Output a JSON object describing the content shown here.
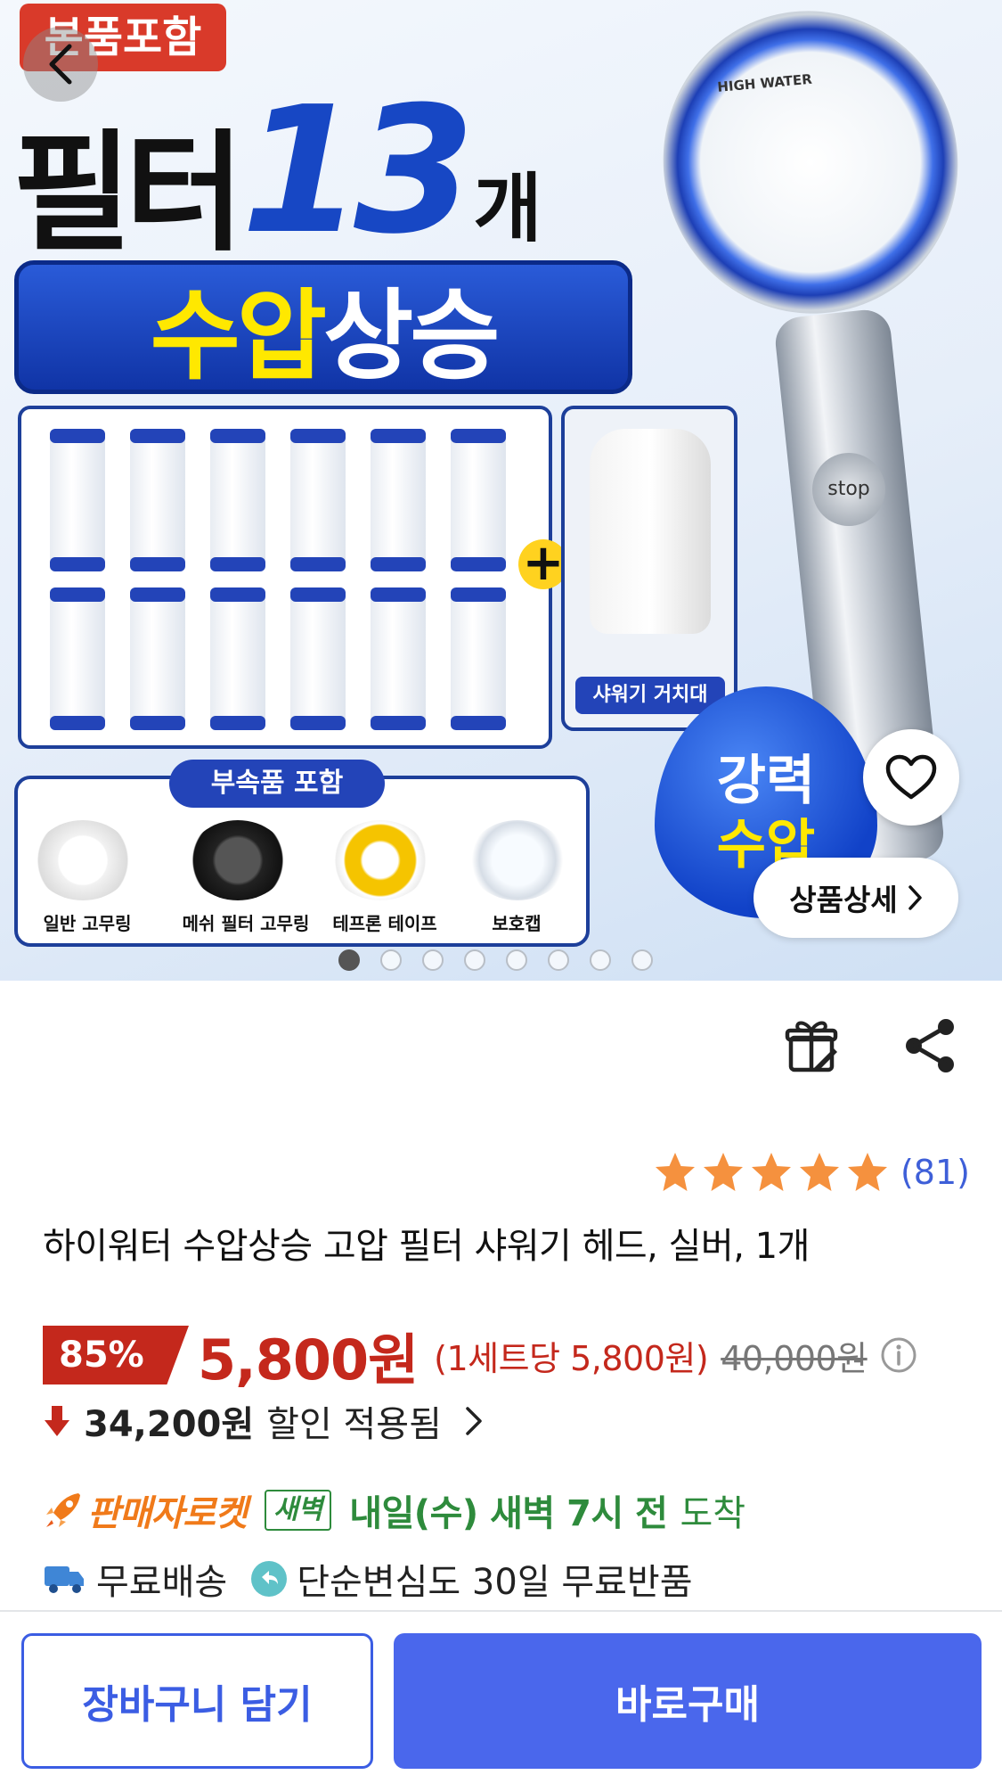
{
  "hero": {
    "badge": "본품포함",
    "title_part1": "필터",
    "title_part2": "13",
    "title_part3": "개",
    "banner_yellow": "수압",
    "banner_white": "상승",
    "shower_head_label": "HIGH WATER",
    "stop_label": "stop",
    "holder_label": "샤워기 거치대",
    "accessories_title": "부속품 포함",
    "accessories": [
      "일반 고무링",
      "메쉬 필터 고무링",
      "테프론 테이프",
      "보호캡"
    ],
    "drop_line1": "강력",
    "drop_line2": "수압",
    "detail_button": "상품상세",
    "slide_count": 8,
    "active_slide": 1
  },
  "product": {
    "rating": 5,
    "review_count": "(81)",
    "title": "하이워터 수압상승 고압 필터 샤워기 헤드, 실버, 1개",
    "discount_rate": "85%",
    "sale_price": "5,800원",
    "unit_price": "(1세트당 5,800원)",
    "original_price": "40,000원",
    "discount_amount": "34,200원",
    "discount_applied": "할인 적용됨",
    "delivery": {
      "rocket_label": "판매자로켓",
      "dawn_badge": "새벽",
      "arrival_strong": "내일(수) 새벽 7시 전",
      "arrival_suffix": "도착"
    },
    "shipping": "무료배송",
    "returns": "단순변심도 30일 무료반품"
  },
  "actions": {
    "cart": "장바구니 담기",
    "buy": "바로구매"
  },
  "colors": {
    "price_red": "#c4281c",
    "accent_blue": "#4a67ec",
    "delivery_green": "#2e8b3c",
    "rocket_orange": "#f07a1a",
    "star_orange": "#f5913e"
  }
}
